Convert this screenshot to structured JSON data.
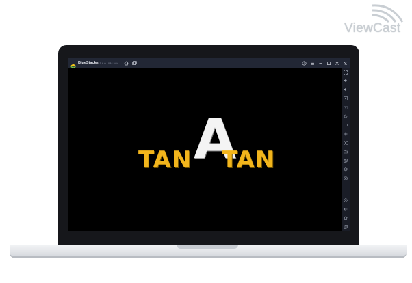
{
  "watermark": {
    "text": "ViewCast"
  },
  "emulator": {
    "app_name": "BlueStacks",
    "version_text": "5.6.0.1034 N64",
    "titlebar_icons_left": [
      "home-icon",
      "multi-instance-icon"
    ],
    "titlebar_icons_right": [
      "help-icon",
      "menu-icon",
      "minimize-icon",
      "maximize-icon",
      "close-icon",
      "collapse-sidebar-icon"
    ],
    "sidebar_icons": [
      "fullscreen-icon",
      "volume-up-icon",
      "volume-down-icon",
      "media-icon",
      "screenshot-icon",
      "rotate-icon",
      "keyboard-icon",
      "controls-icon",
      "screen-record-icon",
      "folder-icon",
      "copy-icon",
      "layers-icon",
      "install-apk-icon",
      "settings-icon",
      "back-icon",
      "android-home-icon",
      "recent-apps-icon"
    ]
  },
  "game": {
    "logo_left": "TAN",
    "logo_middle": "A",
    "logo_right": "TAN",
    "colors": {
      "yellow": "#f2b51c",
      "white": "#f4f4f4",
      "background": "#000000"
    }
  }
}
